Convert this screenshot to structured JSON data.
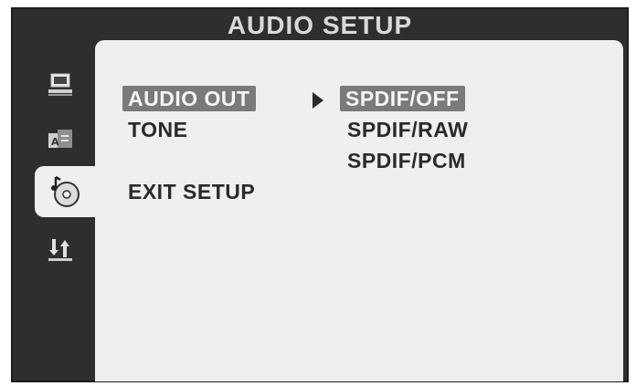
{
  "header": {
    "title": "AUDIO SETUP"
  },
  "sidebar": {
    "tabs": [
      {
        "icon": "monitor-icon",
        "active": false
      },
      {
        "icon": "language-icon",
        "active": false
      },
      {
        "icon": "audio-disc-icon",
        "active": true
      },
      {
        "icon": "preferences-icon",
        "active": false
      }
    ]
  },
  "menu": {
    "items": [
      {
        "label": "AUDIO OUT",
        "selected": true
      },
      {
        "label": "TONE",
        "selected": false
      },
      {
        "label": "EXIT SETUP",
        "selected": false
      }
    ]
  },
  "submenu": {
    "options": [
      {
        "label": "SPDIF/OFF",
        "selected": true
      },
      {
        "label": "SPDIF/RAW",
        "selected": false
      },
      {
        "label": "SPDIF/PCM",
        "selected": false
      }
    ]
  },
  "colors": {
    "frame": "#2e2e2e",
    "panel": "#efefef",
    "highlight": "#7a7a7a",
    "title_text": "#d9d9d9",
    "text": "#2a2a2a"
  }
}
